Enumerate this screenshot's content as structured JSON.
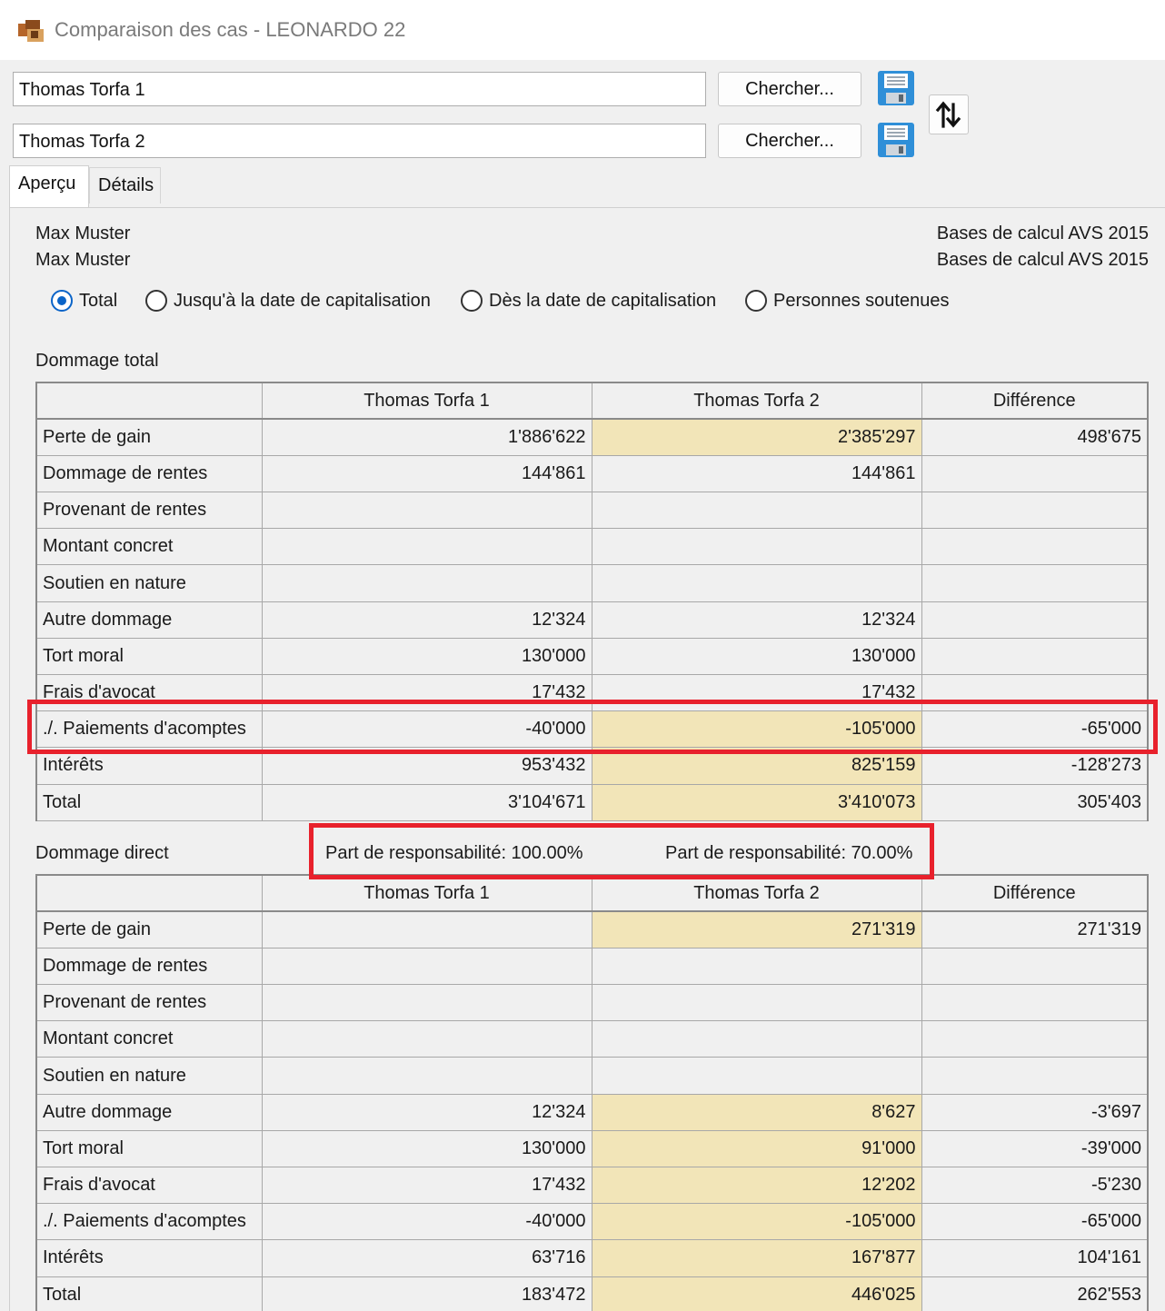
{
  "window": {
    "title": "Comparaison des cas - LEONARDO 22"
  },
  "cases": [
    {
      "value": "Thomas Torfa 1",
      "search_label": "Chercher..."
    },
    {
      "value": "Thomas Torfa 2",
      "search_label": "Chercher..."
    }
  ],
  "tabs": [
    {
      "label": "Aperçu",
      "active": true
    },
    {
      "label": "Détails",
      "active": false
    }
  ],
  "header": {
    "person_1": "Max Muster",
    "person_2": "Max Muster",
    "basis_1": "Bases de calcul AVS 2015",
    "basis_2": "Bases de calcul AVS 2015"
  },
  "view_options": [
    {
      "label": "Total",
      "selected": true
    },
    {
      "label": "Jusqu'à la date de capitalisation",
      "selected": false
    },
    {
      "label": "Dès la date de capitalisation",
      "selected": false
    },
    {
      "label": "Personnes soutenues",
      "selected": false
    }
  ],
  "highlight_color": "#f2e5b8",
  "annotation_color": "#e8212c",
  "total_table": {
    "section_label": "Dommage total",
    "columns": [
      "",
      "Thomas Torfa 1",
      "Thomas Torfa 2",
      "Différence"
    ],
    "rows": [
      {
        "label": "Perte de gain",
        "c1": "1'886'622",
        "c2": "2'385'297",
        "diff": "498'675",
        "hl": true
      },
      {
        "label": "Dommage de rentes",
        "c1": "144'861",
        "c2": "144'861",
        "diff": "",
        "hl": false
      },
      {
        "label": "Provenant de rentes",
        "c1": "",
        "c2": "",
        "diff": "",
        "hl": false
      },
      {
        "label": "Montant concret",
        "c1": "",
        "c2": "",
        "diff": "",
        "hl": false
      },
      {
        "label": "Soutien en nature",
        "c1": "",
        "c2": "",
        "diff": "",
        "hl": false
      },
      {
        "label": "Autre dommage",
        "c1": "12'324",
        "c2": "12'324",
        "diff": "",
        "hl": false
      },
      {
        "label": "Tort moral",
        "c1": "130'000",
        "c2": "130'000",
        "diff": "",
        "hl": false
      },
      {
        "label": "Frais d'avocat",
        "c1": "17'432",
        "c2": "17'432",
        "diff": "",
        "hl": false
      },
      {
        "label": "./. Paiements d'acomptes",
        "c1": "-40'000",
        "c2": "-105'000",
        "diff": "-65'000",
        "hl": true
      },
      {
        "label": "Intérêts",
        "c1": "953'432",
        "c2": "825'159",
        "diff": "-128'273",
        "hl": true
      },
      {
        "label": "Total",
        "c1": "3'104'671",
        "c2": "3'410'073",
        "diff": "305'403",
        "hl": true
      }
    ]
  },
  "direct_table": {
    "section_label": "Dommage direct",
    "responsibility_1": "Part de responsabilité: 100.00%",
    "responsibility_2": "Part de responsabilité: 70.00%",
    "columns": [
      "",
      "Thomas Torfa 1",
      "Thomas Torfa 2",
      "Différence"
    ],
    "rows": [
      {
        "label": "Perte de gain",
        "c1": "",
        "c2": "271'319",
        "diff": "271'319",
        "hl": true
      },
      {
        "label": "Dommage de rentes",
        "c1": "",
        "c2": "",
        "diff": "",
        "hl": false
      },
      {
        "label": "Provenant de rentes",
        "c1": "",
        "c2": "",
        "diff": "",
        "hl": false
      },
      {
        "label": "Montant concret",
        "c1": "",
        "c2": "",
        "diff": "",
        "hl": false
      },
      {
        "label": "Soutien en nature",
        "c1": "",
        "c2": "",
        "diff": "",
        "hl": false
      },
      {
        "label": "Autre dommage",
        "c1": "12'324",
        "c2": "8'627",
        "diff": "-3'697",
        "hl": true
      },
      {
        "label": "Tort moral",
        "c1": "130'000",
        "c2": "91'000",
        "diff": "-39'000",
        "hl": true
      },
      {
        "label": "Frais d'avocat",
        "c1": "17'432",
        "c2": "12'202",
        "diff": "-5'230",
        "hl": true
      },
      {
        "label": "./. Paiements d'acomptes",
        "c1": "-40'000",
        "c2": "-105'000",
        "diff": "-65'000",
        "hl": true
      },
      {
        "label": "Intérêts",
        "c1": "63'716",
        "c2": "167'877",
        "diff": "104'161",
        "hl": true
      },
      {
        "label": "Total",
        "c1": "183'472",
        "c2": "446'025",
        "diff": "262'553",
        "hl": true
      }
    ]
  }
}
